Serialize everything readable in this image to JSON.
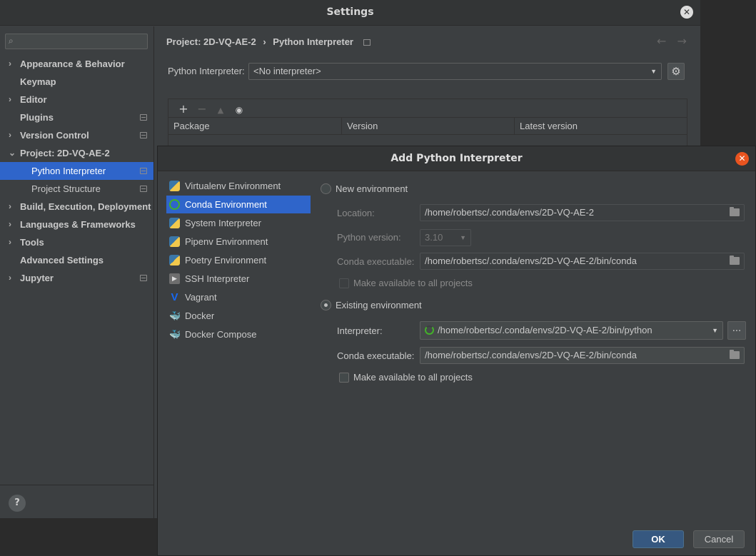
{
  "settings": {
    "title": "Settings",
    "search": {
      "placeholder": ""
    },
    "tree": [
      {
        "label": "Appearance & Behavior",
        "arrow": "›",
        "bold": true
      },
      {
        "label": "Keymap",
        "arrow": "",
        "bold": true
      },
      {
        "label": "Editor",
        "arrow": "›",
        "bold": true
      },
      {
        "label": "Plugins",
        "arrow": "",
        "bold": true
      },
      {
        "label": "Version Control",
        "arrow": "›",
        "bold": true
      },
      {
        "label": "Project: 2D-VQ-AE-2",
        "arrow": "⌄",
        "bold": true
      },
      {
        "label": "Python Interpreter",
        "arrow": "",
        "bold": false,
        "selected": true
      },
      {
        "label": "Project Structure",
        "arrow": "",
        "bold": false
      },
      {
        "label": "Build, Execution, Deployment",
        "arrow": "›",
        "bold": true
      },
      {
        "label": "Languages & Frameworks",
        "arrow": "›",
        "bold": true
      },
      {
        "label": "Tools",
        "arrow": "›",
        "bold": true
      },
      {
        "label": "Advanced Settings",
        "arrow": "",
        "bold": true
      },
      {
        "label": "Jupyter",
        "arrow": "›",
        "bold": true
      }
    ],
    "help": "?",
    "breadcrumb": {
      "project": "Project: 2D-VQ-AE-2",
      "separator": "›",
      "page": "Python Interpreter"
    },
    "nav": {
      "back": "←",
      "forward": "→"
    },
    "interpreter_label": "Python Interpreter:",
    "interpreter_value": "<No interpreter>",
    "packages": {
      "toolbar": [
        "+",
        "−",
        "▲",
        "👁"
      ],
      "columns": [
        "Package",
        "Version",
        "Latest version"
      ]
    }
  },
  "dialog": {
    "title": "Add Python Interpreter",
    "env_types": [
      {
        "label": "Virtualenv Environment",
        "icon": "python-icon"
      },
      {
        "label": "Conda Environment",
        "icon": "conda-icon",
        "selected": true
      },
      {
        "label": "System Interpreter",
        "icon": "python-icon"
      },
      {
        "label": "Pipenv Environment",
        "icon": "pipenv-icon"
      },
      {
        "label": "Poetry Environment",
        "icon": "poetry-icon"
      },
      {
        "label": "SSH Interpreter",
        "icon": "ssh-icon"
      },
      {
        "label": "Vagrant",
        "icon": "vagrant-icon"
      },
      {
        "label": "Docker",
        "icon": "docker-icon"
      },
      {
        "label": "Docker Compose",
        "icon": "docker-compose-icon"
      }
    ],
    "new_env": {
      "label": "New environment",
      "location_label": "Location:",
      "location_value": "/home/robertsc/.conda/envs/2D-VQ-AE-2",
      "python_version_label": "Python version:",
      "python_version_value": "3.10",
      "conda_exec_label": "Conda executable:",
      "conda_exec_value": "/home/robertsc/.conda/envs/2D-VQ-AE-2/bin/conda",
      "make_available": "Make available to all projects"
    },
    "existing_env": {
      "label": "Existing environment",
      "interpreter_label": "Interpreter:",
      "interpreter_value": "/home/robertsc/.conda/envs/2D-VQ-AE-2/bin/python",
      "browse": "...",
      "conda_exec_label": "Conda executable:",
      "conda_exec_value": "/home/robertsc/.conda/envs/2D-VQ-AE-2/bin/conda",
      "make_available": "Make available to all projects"
    },
    "ok": "OK",
    "cancel": "Cancel"
  }
}
